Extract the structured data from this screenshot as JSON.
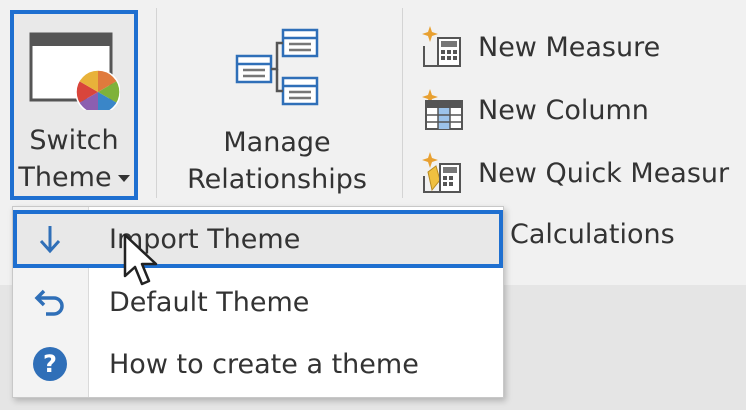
{
  "ribbon": {
    "switch_theme": {
      "line1": "Switch",
      "line2": "Theme"
    },
    "manage_relationships": {
      "line1": "Manage",
      "line2": "Relationships"
    },
    "calculations": {
      "new_measure": "New Measure",
      "new_column": "New Column",
      "new_quick_measure": "New Quick Measur",
      "group_label": "Calculations"
    }
  },
  "theme_menu": {
    "items": [
      {
        "label": "Import Theme",
        "icon": "arrow-down-icon",
        "highlighted": true
      },
      {
        "label": "Default Theme",
        "icon": "undo-icon",
        "highlighted": false
      },
      {
        "label": "How to create a theme",
        "icon": "help-icon",
        "highlighted": false
      }
    ]
  },
  "colors": {
    "highlight_border": "#1e6fd0",
    "icon_blue": "#2f6fb8"
  }
}
